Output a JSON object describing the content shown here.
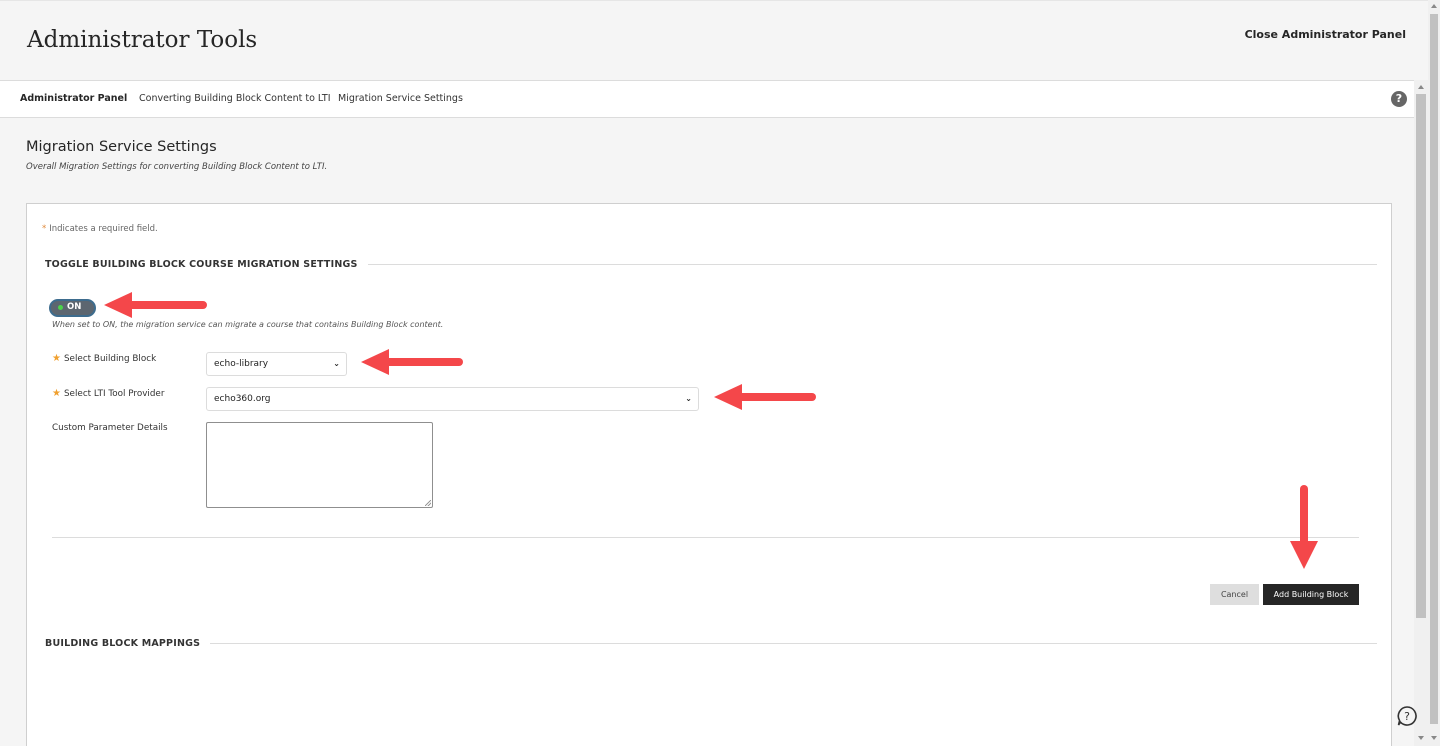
{
  "header": {
    "title": "Administrator Tools",
    "close_label": "Close Administrator Panel"
  },
  "nav": {
    "items": [
      {
        "label": "Administrator Panel",
        "active": true
      },
      {
        "label": "Converting Building Block Content to LTI",
        "active": false
      },
      {
        "label": "Migration Service Settings",
        "active": false
      }
    ],
    "help_icon": "?"
  },
  "page": {
    "heading": "Migration Service Settings",
    "subheading": "Overall Migration Settings for converting Building Block Content to LTI."
  },
  "form": {
    "required_star": "*",
    "required_note": "Indicates a required field.",
    "section_toggle_title": "TOGGLE BUILDING BLOCK COURSE MIGRATION SETTINGS",
    "toggle": {
      "label": "ON",
      "state": "on",
      "help": "When set to ON, the migration service can migrate a course that contains Building Block content."
    },
    "fields": {
      "building_block": {
        "label": "Select Building Block",
        "required": true,
        "value": "echo-library"
      },
      "lti_provider": {
        "label": "Select LTI Tool Provider",
        "required": true,
        "value": "echo360.org"
      },
      "custom_params": {
        "label": "Custom Parameter Details",
        "value": ""
      }
    },
    "buttons": {
      "cancel": "Cancel",
      "add": "Add Building Block"
    },
    "section_mappings_title": "BUILDING BLOCK MAPPINGS"
  },
  "colors": {
    "annotation_arrow": "#f4474a",
    "primary_button": "#262626",
    "toggle_bg": "#5c6670",
    "required_star": "#f0a030"
  }
}
